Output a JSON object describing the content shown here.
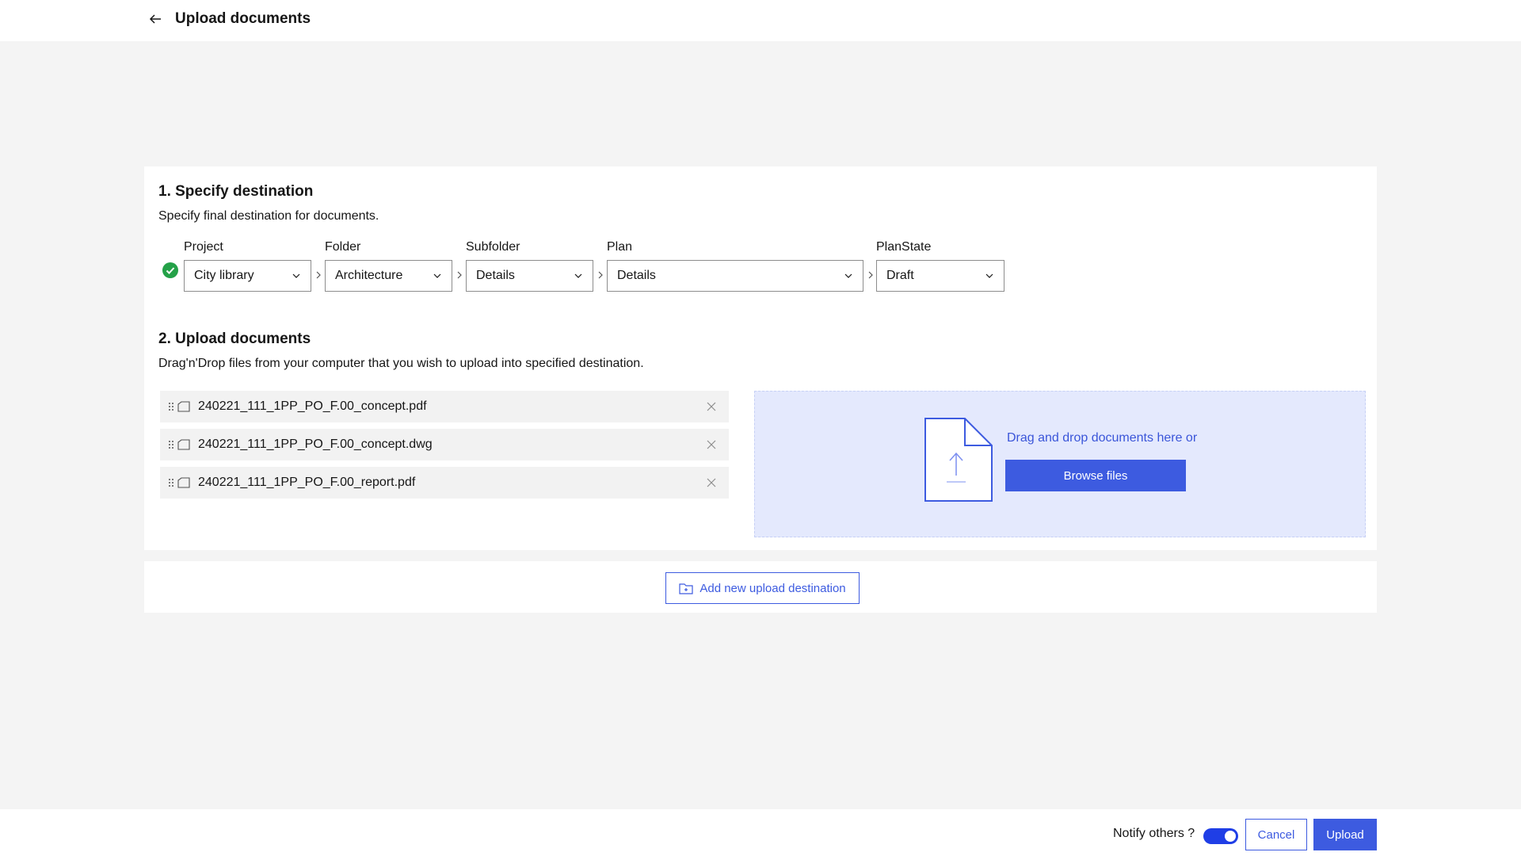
{
  "header": {
    "title": "Upload documents",
    "back_icon": "arrow-left-icon"
  },
  "destination": {
    "title": "1. Specify destination",
    "description": "Specify final destination for documents.",
    "status_color": "#24a148",
    "fields": [
      {
        "label": "Project",
        "value": "City library"
      },
      {
        "label": "Folder",
        "value": "Architecture"
      },
      {
        "label": "Subfolder",
        "value": "Details"
      },
      {
        "label": "Plan",
        "value": "Details"
      },
      {
        "label": "PlanState",
        "value": "Draft"
      }
    ]
  },
  "upload": {
    "title": "2. Upload documents",
    "description": "Drag'n'Drop files from your computer that you wish to upload into specified destination.",
    "files": [
      {
        "name": "240221_111_1PP_PO_F.00_concept.pdf"
      },
      {
        "name": "240221_111_1PP_PO_F.00_concept.dwg"
      },
      {
        "name": "240221_111_1PP_PO_F.00_report.pdf"
      }
    ],
    "dropzone": {
      "text": "Drag and drop documents here or",
      "browse_label": "Browse files"
    }
  },
  "add_destination_label": "Add new upload destination",
  "footer": {
    "notify_label": "Notify others ?",
    "notify_on": true,
    "cancel_label": "Cancel",
    "upload_label": "Upload"
  },
  "colors": {
    "accent": "#3d5be0",
    "dropzone_bg": "#e4e9fd",
    "page_bg": "#f4f4f4"
  }
}
